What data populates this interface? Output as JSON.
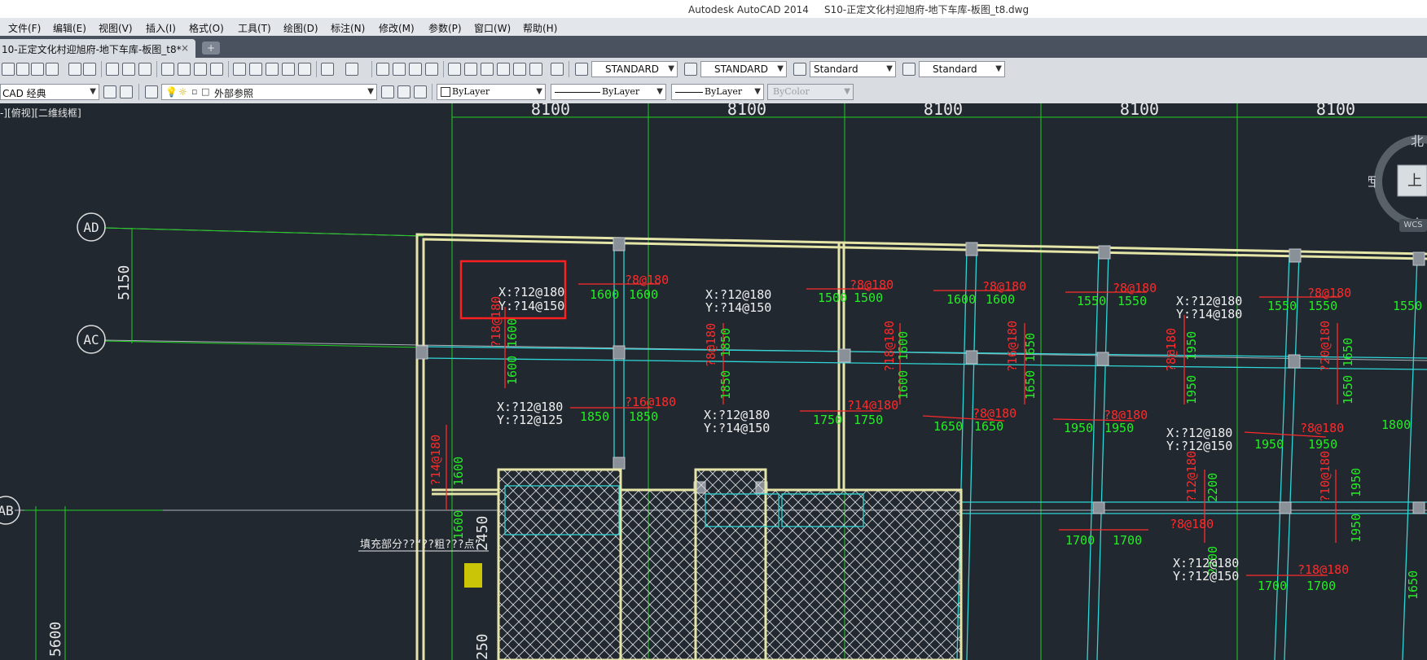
{
  "window_title": "Autodesk AutoCAD 2014     S10-正定文化村迎旭府-地下车库-板图_t8.dwg",
  "menu": [
    "文件(F)",
    "编辑(E)",
    "视图(V)",
    "插入(I)",
    "格式(O)",
    "工具(T)",
    "绘图(D)",
    "标注(N)",
    "修改(M)",
    "参数(P)",
    "窗口(W)",
    "帮助(H)"
  ],
  "tab": {
    "label": "10-正定文化村迎旭府-地下车库-板图_t8*",
    "close": "×",
    "new": "+"
  },
  "styles": {
    "text_style": "STANDARD",
    "dim_style": "STANDARD",
    "table_style": "Standard",
    "mleader_style": "Standard"
  },
  "workspace": "CAD 经典",
  "layer": "外部参照",
  "properties": {
    "color": "ByLayer",
    "linetype": "ByLayer",
    "lineweight": "ByLayer",
    "plotstyle": "ByColor"
  },
  "view_label": "-][俯视][二维线框]",
  "viewcube": {
    "north": "北",
    "west": "西",
    "south": "南",
    "top": "上",
    "wcs": "WCS"
  },
  "drawing": {
    "spans": [
      "8100",
      "8100",
      "8100",
      "8100",
      "8100"
    ],
    "axes": [
      "AD",
      "AC",
      "AB"
    ],
    "dims_vertical": [
      "5150",
      "5600",
      "2450",
      "250"
    ],
    "slab_notes": [
      {
        "x": "X:?12@180",
        "y": "Y:?14@150"
      },
      {
        "x": "X:?12@180",
        "y": "Y:?14@150"
      },
      {
        "x": "X:?12@180",
        "y": "Y:?14@180"
      },
      {
        "x": "X:?12@180",
        "y": "Y:?12@125"
      },
      {
        "x": "X:?12@180",
        "y": "Y:?14@150"
      },
      {
        "x": "X:?12@180",
        "y": "Y:?12@150"
      },
      {
        "x": "X:?12@180",
        "y": "Y:?12@150"
      }
    ],
    "rebar_red": [
      "?8@180",
      "?8@180",
      "?8@180",
      "?8@180",
      "?8@180",
      "?16@180",
      "?14@180",
      "?8@180",
      "?8@180",
      "?8@180",
      "?8@180",
      "?18@180",
      "?18@180",
      "?8@180",
      "?18@180",
      "?16@180",
      "?8@180",
      "?20@180",
      "?14@180",
      "?12@180",
      "?10@180",
      "?12@180",
      "?8@180"
    ],
    "dim_green_h": [
      "1600",
      "1600",
      "1500",
      "1500",
      "1600",
      "1600",
      "1550",
      "1550",
      "1550",
      "1550",
      "1550",
      "1850",
      "1850",
      "1750",
      "1750",
      "1650",
      "1650",
      "1950",
      "1950",
      "1950",
      "1950",
      "1800",
      "1700",
      "1700",
      "1700",
      "1700"
    ],
    "dim_green_v": [
      "1600",
      "1600",
      "1850",
      "1850",
      "1600",
      "1600",
      "1650",
      "1650",
      "1950",
      "1950",
      "1650",
      "1650",
      "1600",
      "1600",
      "2200",
      "2200",
      "1950",
      "1950",
      "1650"
    ],
    "fill_note": "填充部分??“??粗???点”"
  },
  "colors": {
    "canvas": "#212830",
    "grid": "#1fd01f",
    "wall": "#e5e5a8",
    "beam": "#2fd6d6",
    "rebar": "#ff2a2a",
    "dim": "#22ee22",
    "highlight": "#ff2020"
  }
}
